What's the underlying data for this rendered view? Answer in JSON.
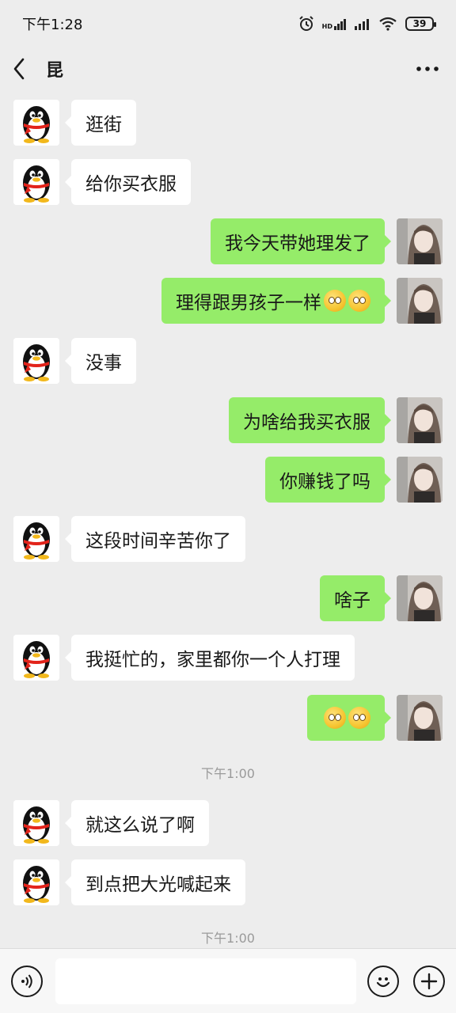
{
  "status_bar": {
    "time": "下午1:28",
    "signal_label": "HD",
    "battery": "39"
  },
  "nav": {
    "title": "昆"
  },
  "messages": [
    {
      "side": "in",
      "text": "逛街"
    },
    {
      "side": "in",
      "text": "给你买衣服"
    },
    {
      "side": "out",
      "text": "我今天带她理发了"
    },
    {
      "side": "out",
      "text": "理得跟男孩子一样",
      "emoji": [
        "dizzy-face-emoji",
        "dizzy-face-emoji"
      ]
    },
    {
      "side": "in",
      "text": "没事"
    },
    {
      "side": "out",
      "text": "为啥给我买衣服"
    },
    {
      "side": "out",
      "text": "你赚钱了吗"
    },
    {
      "side": "in",
      "text": "这段时间辛苦你了"
    },
    {
      "side": "out",
      "text": "啥子"
    },
    {
      "side": "in",
      "text": "我挺忙的，家里都你一个人打理"
    },
    {
      "side": "out",
      "text": "",
      "emoji": [
        "astonished-face-emoji",
        "astonished-face-emoji"
      ]
    },
    {
      "side": "in",
      "text": "就这么说了啊"
    },
    {
      "side": "in",
      "text": "到点把大光喊起来"
    }
  ],
  "timestamps": [
    "下午1:00",
    "下午1:00"
  ],
  "input_bar": {
    "voice_icon": "voice-icon",
    "emoji_icon": "smiley-icon",
    "plus_icon": "plus-icon",
    "value": ""
  },
  "colors": {
    "background": "#ededed",
    "outgoing_bubble": "#95ec69",
    "incoming_bubble": "#ffffff",
    "input_bar": "#f7f7f7"
  }
}
